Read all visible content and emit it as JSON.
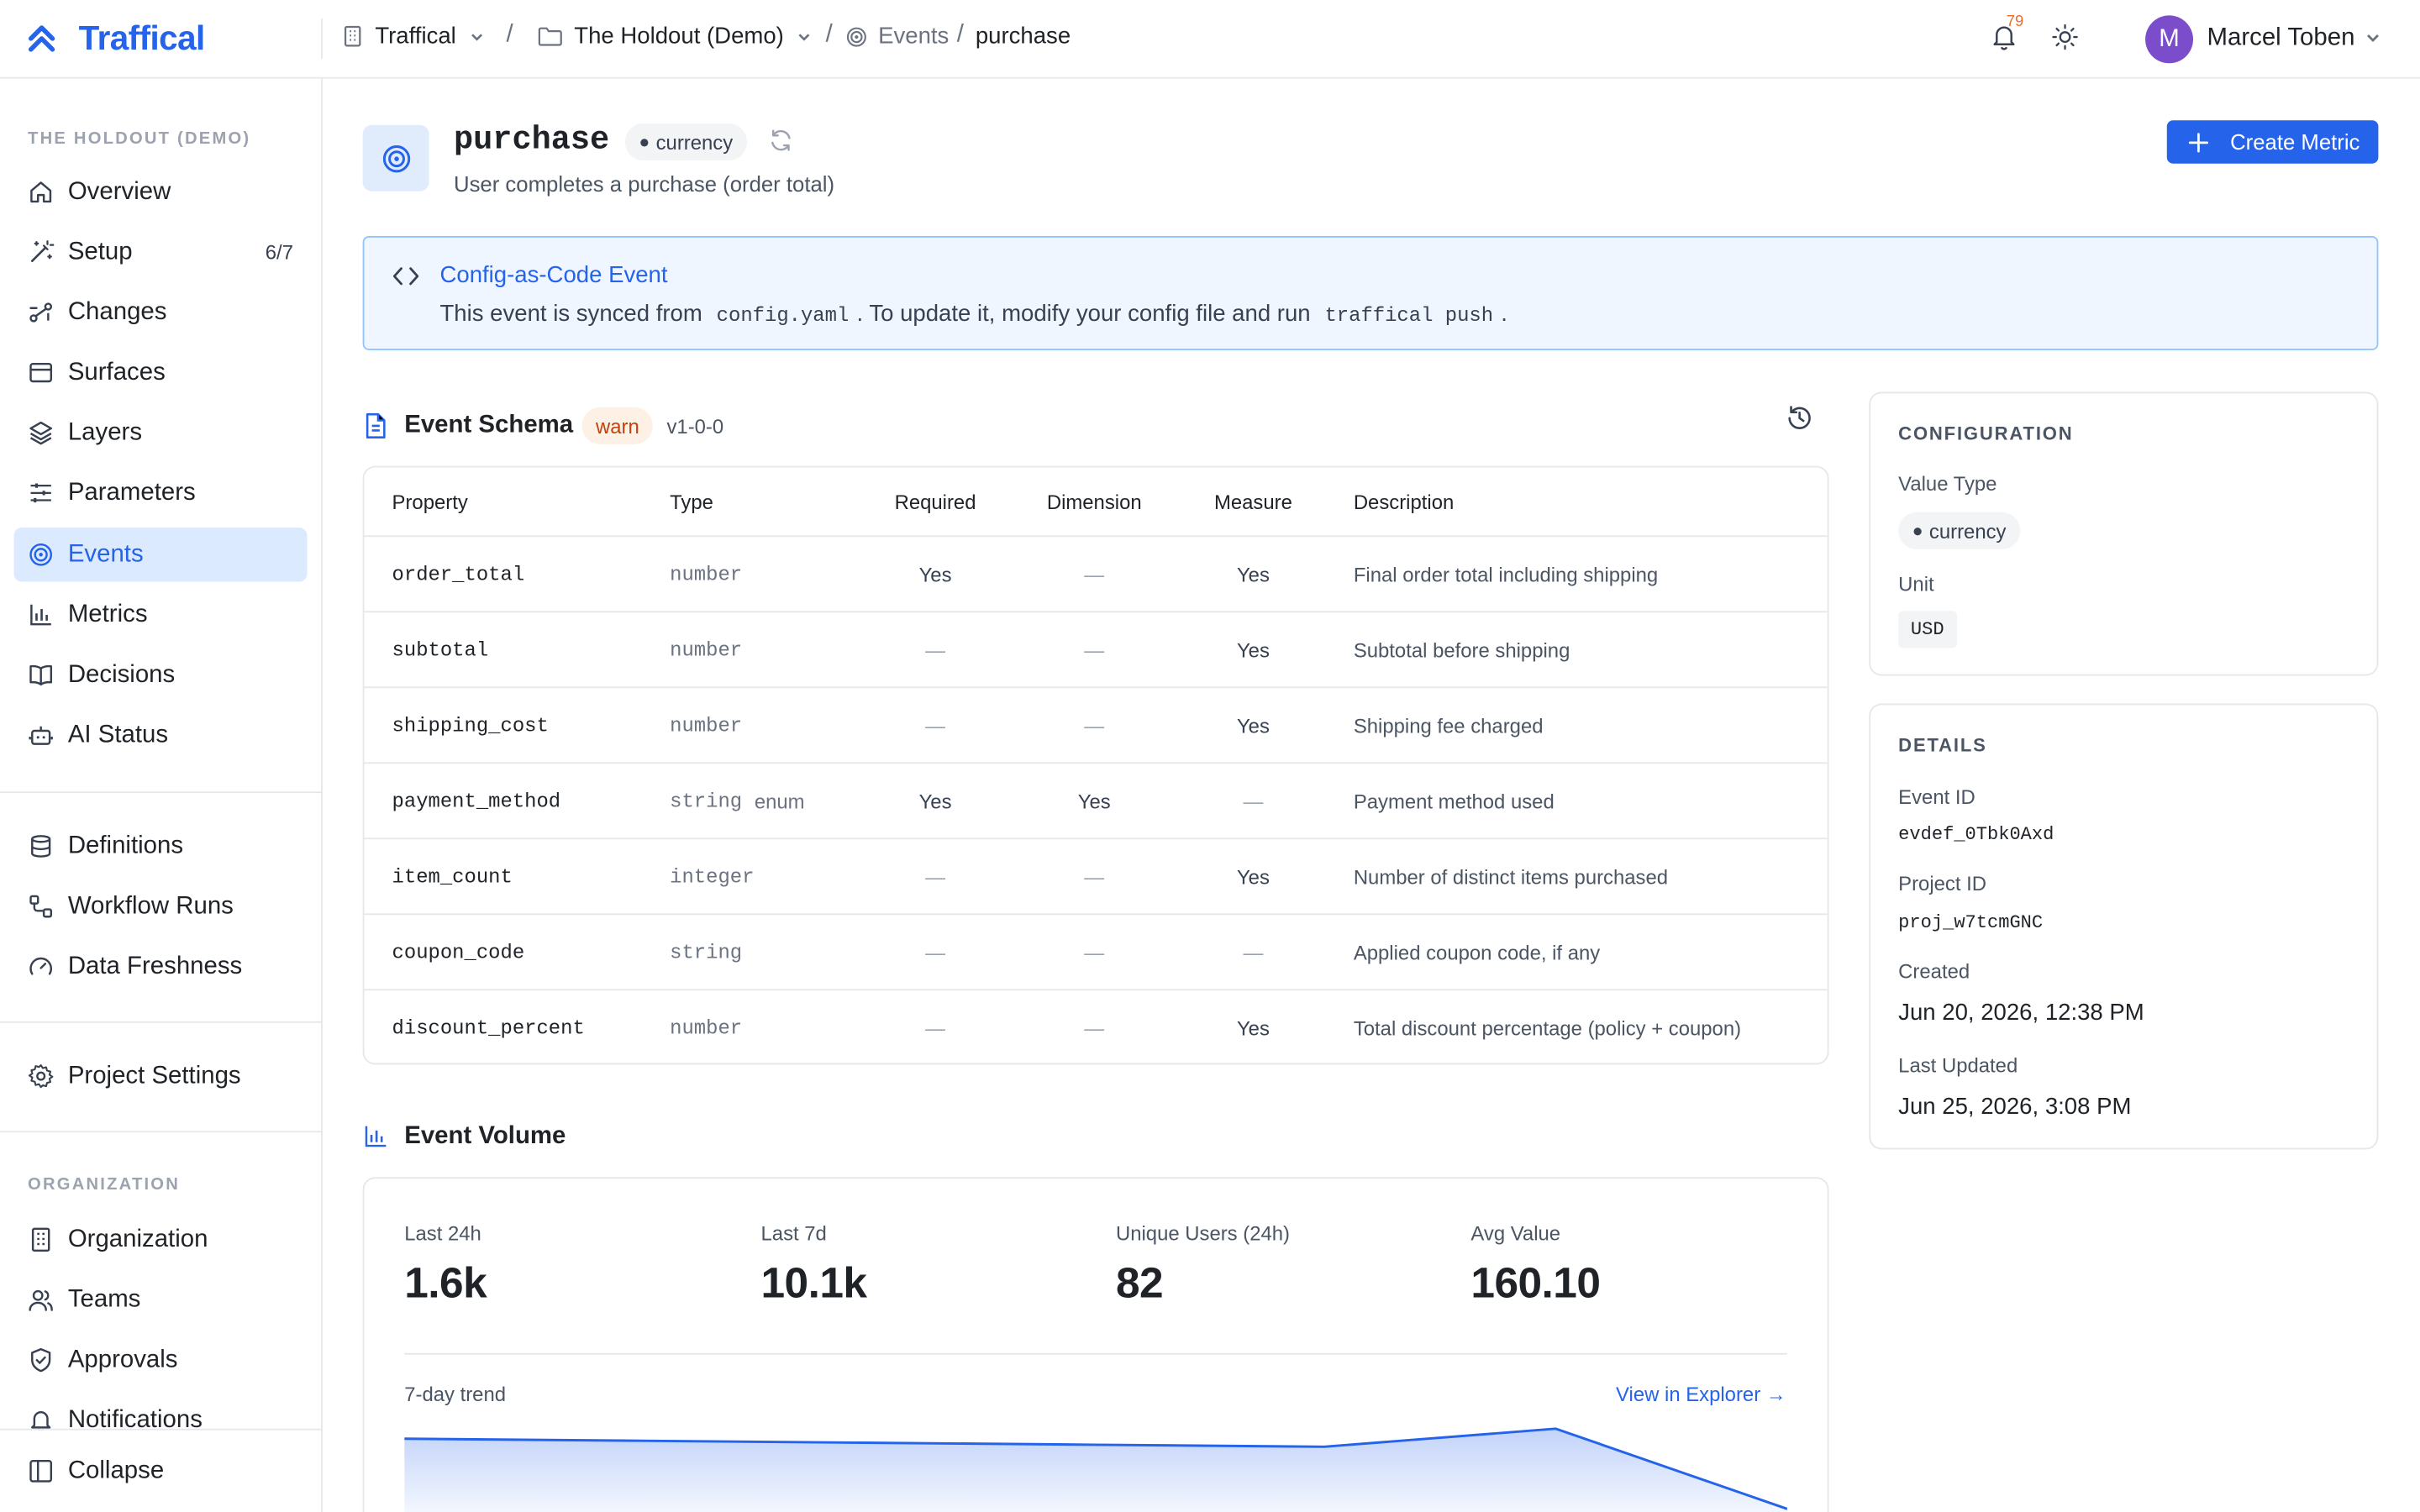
{
  "brand": {
    "name": "Traffical"
  },
  "breadcrumb": {
    "org": "Traffical",
    "project": "The Holdout (Demo)",
    "section": "Events",
    "current": "purchase",
    "separator": "/"
  },
  "topbar": {
    "notification_count": "79",
    "user_initial": "M",
    "user_name": "Marcel Toben"
  },
  "sidebar": {
    "project_heading": "THE HOLDOUT (DEMO)",
    "items": [
      {
        "label": "Overview",
        "icon": "home-icon"
      },
      {
        "label": "Setup",
        "icon": "wand-icon",
        "count": "6/7"
      },
      {
        "label": "Changes",
        "icon": "changes-icon"
      },
      {
        "label": "Surfaces",
        "icon": "browser-icon"
      },
      {
        "label": "Layers",
        "icon": "layers-icon"
      },
      {
        "label": "Parameters",
        "icon": "sliders-icon"
      },
      {
        "label": "Events",
        "icon": "target-icon",
        "active": true
      },
      {
        "label": "Metrics",
        "icon": "bar-chart-icon"
      },
      {
        "label": "Decisions",
        "icon": "book-icon"
      },
      {
        "label": "AI Status",
        "icon": "bot-icon"
      }
    ],
    "items2": [
      {
        "label": "Definitions",
        "icon": "database-icon"
      },
      {
        "label": "Workflow Runs",
        "icon": "workflow-icon"
      },
      {
        "label": "Data Freshness",
        "icon": "gauge-icon"
      }
    ],
    "project_settings": "Project Settings",
    "org_heading": "ORGANIZATION",
    "org_items": [
      {
        "label": "Organization",
        "icon": "building-icon"
      },
      {
        "label": "Teams",
        "icon": "users-icon"
      },
      {
        "label": "Approvals",
        "icon": "shield-check-icon"
      },
      {
        "label": "Notifications",
        "icon": "bell-icon"
      }
    ],
    "collapse": "Collapse"
  },
  "event": {
    "name": "purchase",
    "value_type": "currency",
    "description": "User completes a purchase (order total)",
    "create_metric": "Create Metric"
  },
  "banner": {
    "title": "Config-as-Code Event",
    "text_1": "This event is synced from",
    "file": "config.yaml",
    "text_2": ". To update it, modify your config file and run",
    "command": "traffical push",
    "text_3": "."
  },
  "schema": {
    "title": "Event Schema",
    "badge": "warn",
    "version": "v1-0-0",
    "columns": [
      "Property",
      "Type",
      "Required",
      "Dimension",
      "Measure",
      "Description"
    ],
    "rows": [
      {
        "property": "order_total",
        "type": "number",
        "enum": "",
        "required": "Yes",
        "dimension": "—",
        "measure": "Yes",
        "description": "Final order total including shipping"
      },
      {
        "property": "subtotal",
        "type": "number",
        "enum": "",
        "required": "—",
        "dimension": "—",
        "measure": "Yes",
        "description": "Subtotal before shipping"
      },
      {
        "property": "shipping_cost",
        "type": "number",
        "enum": "",
        "required": "—",
        "dimension": "—",
        "measure": "Yes",
        "description": "Shipping fee charged"
      },
      {
        "property": "payment_method",
        "type": "string",
        "enum": "enum",
        "required": "Yes",
        "dimension": "Yes",
        "measure": "—",
        "description": "Payment method used"
      },
      {
        "property": "item_count",
        "type": "integer",
        "enum": "",
        "required": "—",
        "dimension": "—",
        "measure": "Yes",
        "description": "Number of distinct items purchased"
      },
      {
        "property": "coupon_code",
        "type": "string",
        "enum": "",
        "required": "—",
        "dimension": "—",
        "measure": "—",
        "description": "Applied coupon code, if any"
      },
      {
        "property": "discount_percent",
        "type": "number",
        "enum": "",
        "required": "—",
        "dimension": "—",
        "measure": "Yes",
        "description": "Total discount percentage (policy + coupon)"
      }
    ]
  },
  "configuration": {
    "title": "CONFIGURATION",
    "value_type_label": "Value Type",
    "value_type": "currency",
    "unit_label": "Unit",
    "unit": "USD"
  },
  "details": {
    "title": "DETAILS",
    "event_id_label": "Event ID",
    "event_id": "evdef_0Tbk0Axd",
    "project_id_label": "Project ID",
    "project_id": "proj_w7tcmGNC",
    "created_label": "Created",
    "created": "Jun 20, 2026, 12:38 PM",
    "updated_label": "Last Updated",
    "updated": "Jun 25, 2026, 3:08 PM"
  },
  "volume": {
    "title": "Event Volume",
    "stats": [
      {
        "label": "Last 24h",
        "value": "1.6k"
      },
      {
        "label": "Last 7d",
        "value": "10.1k"
      },
      {
        "label": "Unique Users (24h)",
        "value": "82"
      },
      {
        "label": "Avg Value",
        "value": "160.10"
      }
    ],
    "trend_label": "7-day trend",
    "explorer_link": "View in Explorer →",
    "trend_relative": [
      0.95,
      0.94,
      0.93,
      0.92,
      0.91,
      1.0,
      0.6
    ],
    "accent": "#2563eb"
  }
}
